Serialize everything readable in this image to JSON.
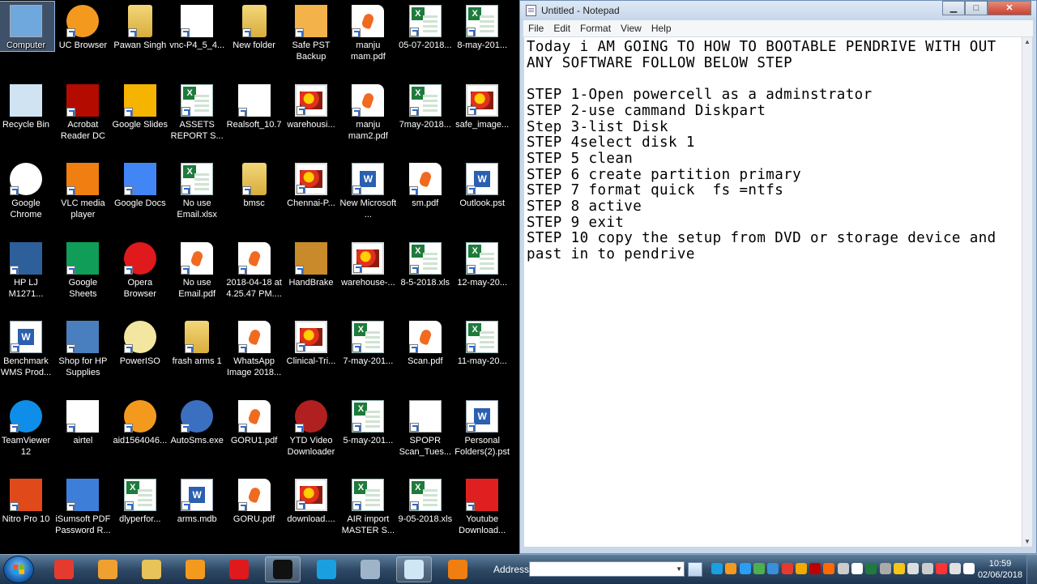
{
  "desktop": {
    "icons": [
      {
        "label": "Computer",
        "type": "computer",
        "name": "computer-icon"
      },
      {
        "label": "UC Browser",
        "type": "uc",
        "name": "uc-browser-icon"
      },
      {
        "label": "Pawan Singh",
        "type": "userfolder",
        "name": "user-folder-icon"
      },
      {
        "label": "vnc-P4_5_4...",
        "type": "vnc",
        "name": "vnc-icon"
      },
      {
        "label": "New folder",
        "type": "folder",
        "name": "folder-icon"
      },
      {
        "label": "Safe PST Backup",
        "type": "pst",
        "name": "safe-pst-backup-icon"
      },
      {
        "label": "manju mam.pdf",
        "type": "pdf",
        "name": "pdf-file-icon"
      },
      {
        "label": "05-07-2018...",
        "type": "xls",
        "name": "excel-file-icon"
      },
      {
        "label": "8-may-201...",
        "type": "xls",
        "name": "excel-file-icon"
      },
      {
        "label": "Recycle Bin",
        "type": "recycle",
        "name": "recycle-bin-icon"
      },
      {
        "label": "Acrobat Reader DC",
        "type": "acrobat",
        "name": "acrobat-reader-icon"
      },
      {
        "label": "Google Slides",
        "type": "gslides",
        "name": "google-slides-icon"
      },
      {
        "label": "ASSETS REPORT S...",
        "type": "xls",
        "name": "excel-file-icon"
      },
      {
        "label": "Realsoft_10.7",
        "type": "realsoft",
        "name": "realsoft-icon"
      },
      {
        "label": "warehousi...",
        "type": "img",
        "name": "image-file-icon"
      },
      {
        "label": "manju mam2.pdf",
        "type": "pdf",
        "name": "pdf-file-icon"
      },
      {
        "label": "7may-2018...",
        "type": "xls",
        "name": "excel-file-icon"
      },
      {
        "label": "safe_image...",
        "type": "img",
        "name": "image-file-icon"
      },
      {
        "label": "Google Chrome",
        "type": "chrome",
        "name": "google-chrome-icon"
      },
      {
        "label": "VLC media player",
        "type": "vlc",
        "name": "vlc-icon"
      },
      {
        "label": "Google Docs",
        "type": "gdocs",
        "name": "google-docs-icon"
      },
      {
        "label": "No use Email.xlsx",
        "type": "xls",
        "name": "excel-file-icon"
      },
      {
        "label": "bmsc",
        "type": "folder",
        "name": "folder-icon"
      },
      {
        "label": "Chennai-P...",
        "type": "img",
        "name": "image-file-icon"
      },
      {
        "label": "New Microsoft ...",
        "type": "word",
        "name": "word-file-icon"
      },
      {
        "label": "sm.pdf",
        "type": "pdf",
        "name": "pdf-file-icon"
      },
      {
        "label": "Outlook.pst",
        "type": "word",
        "name": "pst-file-icon"
      },
      {
        "label": "HP LJ M1271...",
        "type": "scanner",
        "name": "scanner-icon"
      },
      {
        "label": "Google Sheets",
        "type": "gsheets",
        "name": "google-sheets-icon"
      },
      {
        "label": "Opera Browser",
        "type": "opera",
        "name": "opera-icon"
      },
      {
        "label": "No use Email.pdf",
        "type": "pdf",
        "name": "pdf-file-icon"
      },
      {
        "label": "2018-04-18 at 4.25.47 PM....",
        "type": "pdf",
        "name": "pdf-file-icon"
      },
      {
        "label": "HandBrake",
        "type": "handbrake",
        "name": "handbrake-icon"
      },
      {
        "label": "warehouse-...",
        "type": "img",
        "name": "image-file-icon"
      },
      {
        "label": "8-5-2018.xls",
        "type": "xls",
        "name": "excel-file-icon"
      },
      {
        "label": "12-may-20...",
        "type": "xls",
        "name": "excel-file-icon"
      },
      {
        "label": "Benchmark WMS Prod...",
        "type": "word",
        "name": "word-file-icon"
      },
      {
        "label": "Shop for HP Supplies",
        "type": "printer",
        "name": "printer-icon"
      },
      {
        "label": "PowerISO",
        "type": "poweriso",
        "name": "poweriso-icon"
      },
      {
        "label": "frash arms 1",
        "type": "folder",
        "name": "folder-icon"
      },
      {
        "label": "WhatsApp Image 2018...",
        "type": "pdf",
        "name": "pdf-file-icon"
      },
      {
        "label": "Clinical-Tri...",
        "type": "img",
        "name": "image-file-icon"
      },
      {
        "label": "7-may-201...",
        "type": "xls",
        "name": "excel-file-icon"
      },
      {
        "label": "Scan.pdf",
        "type": "pdf",
        "name": "pdf-file-icon"
      },
      {
        "label": "11-may-20...",
        "type": "xls",
        "name": "excel-file-icon"
      },
      {
        "label": "TeamViewer 12",
        "type": "teamviewer",
        "name": "teamviewer-icon"
      },
      {
        "label": "airtel",
        "type": "airtel",
        "name": "airtel-icon"
      },
      {
        "label": "aid1564046...",
        "type": "uc",
        "name": "uc-file-icon"
      },
      {
        "label": "AutoSms.exe",
        "type": "autosms",
        "name": "autosms-icon"
      },
      {
        "label": "GORU1.pdf",
        "type": "pdf",
        "name": "pdf-file-icon"
      },
      {
        "label": "YTD Video Downloader",
        "type": "ytd",
        "name": "ytd-downloader-icon"
      },
      {
        "label": "5-may-201...",
        "type": "xls",
        "name": "excel-file-icon"
      },
      {
        "label": "SPOPR Scan_Tues...",
        "type": "blank",
        "name": "blank-file-icon"
      },
      {
        "label": "Personal Folders(2).pst",
        "type": "word",
        "name": "pst-file-icon"
      },
      {
        "label": "Nitro Pro 10",
        "type": "nitro",
        "name": "nitro-pro-icon"
      },
      {
        "label": "iSumsoft PDF Password R...",
        "type": "isumsoft",
        "name": "isumsoft-icon"
      },
      {
        "label": "dlyperfor...",
        "type": "xls",
        "name": "excel-file-icon"
      },
      {
        "label": "arms.mdb",
        "type": "mdb",
        "name": "access-file-icon"
      },
      {
        "label": "GORU.pdf",
        "type": "pdf",
        "name": "pdf-file-icon"
      },
      {
        "label": "download....",
        "type": "img",
        "name": "image-file-icon"
      },
      {
        "label": "AIR import MASTER S...",
        "type": "xls",
        "name": "excel-file-icon"
      },
      {
        "label": "9-05-2018.xls",
        "type": "xls",
        "name": "excel-file-icon"
      },
      {
        "label": "Youtube Download...",
        "type": "youtube",
        "name": "youtube-downloader-icon"
      }
    ]
  },
  "notepad": {
    "title": "Untitled - Notepad",
    "controls": {
      "minimize": "▁",
      "maximize": "□",
      "close": "✕"
    },
    "menu": [
      "File",
      "Edit",
      "Format",
      "View",
      "Help"
    ],
    "content": "Today i AM GOING TO HOW TO BOOTABLE PENDRIVE WITH OUT ANY SOFTWARE FOLLOW BELOW STEP\n\nSTEP 1-Open powercell as a adminstrator\nSTEP 2-use cammand Diskpart\nStep 3-list Disk\nSTEP 4select disk 1\nSTEP 5 clean\nSTEP 6 create partition primary\nSTEP 7 format quick  fs =ntfs\nSTEP 8 active\nSTEP 9 exit\nSTEP 10 copy the setup from DVD or storage device and past in to pendrive"
  },
  "taskbar": {
    "address_label": "Address",
    "address_value": "",
    "clock_time": "10:59",
    "clock_date": "02/06/2018",
    "apps": [
      {
        "name": "chrome-taskbar-icon",
        "color": "#e53b2f"
      },
      {
        "name": "media-player-taskbar-icon",
        "color": "#f0a030"
      },
      {
        "name": "explorer-taskbar-icon",
        "color": "#e8c35a"
      },
      {
        "name": "uc-browser-taskbar-icon",
        "color": "#f39a1e"
      },
      {
        "name": "opera-taskbar-icon",
        "color": "#e0191c"
      },
      {
        "name": "cmd-taskbar-icon",
        "color": "#111111"
      },
      {
        "name": "skype-taskbar-icon",
        "color": "#1aa0e0"
      },
      {
        "name": "calculator-taskbar-icon",
        "color": "#9fb4c8"
      },
      {
        "name": "notepad-taskbar-icon",
        "color": "#cfe6f4"
      },
      {
        "name": "vlc-taskbar-icon",
        "color": "#f07e10"
      }
    ],
    "tray_colors": [
      "#1aa0e0",
      "#f39a1e",
      "#2a9ef0",
      "#4caf50",
      "#3b8ed8",
      "#e53b2f",
      "#f2a900",
      "#c00000",
      "#ff6a00",
      "#cccccc",
      "#ffffff",
      "#1e7b3c",
      "#aaaaaa",
      "#f5c518",
      "#dddddd",
      "#cccccc",
      "#ff3333",
      "#e0e0e0",
      "#ffffff"
    ]
  }
}
